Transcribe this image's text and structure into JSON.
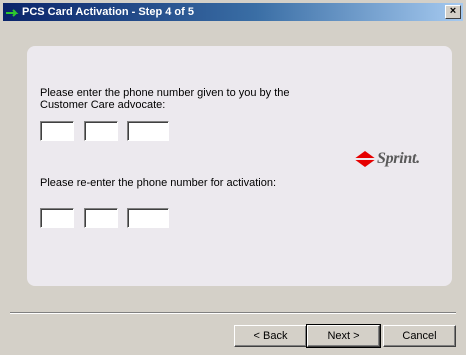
{
  "window": {
    "title": "PCS Card Activation - Step 4 of 5",
    "close_glyph": "×"
  },
  "form": {
    "prompt1": "Please enter the phone number given to you by the Customer Care advocate:",
    "prompt2": "Please re-enter the phone number for activation:",
    "phone1": {
      "area": "",
      "prefix": "",
      "line": ""
    },
    "phone2": {
      "area": "",
      "prefix": "",
      "line": ""
    }
  },
  "logo": {
    "text": "Sprint.",
    "color": "#e60000"
  },
  "buttons": {
    "back": "< Back",
    "next": "Next >",
    "cancel": "Cancel"
  },
  "colors": {
    "title_gradient_start": "#0a246a",
    "title_gradient_end": "#a6caf0",
    "panel_bg": "#ece9ee",
    "window_bg": "#d4d0c8"
  }
}
